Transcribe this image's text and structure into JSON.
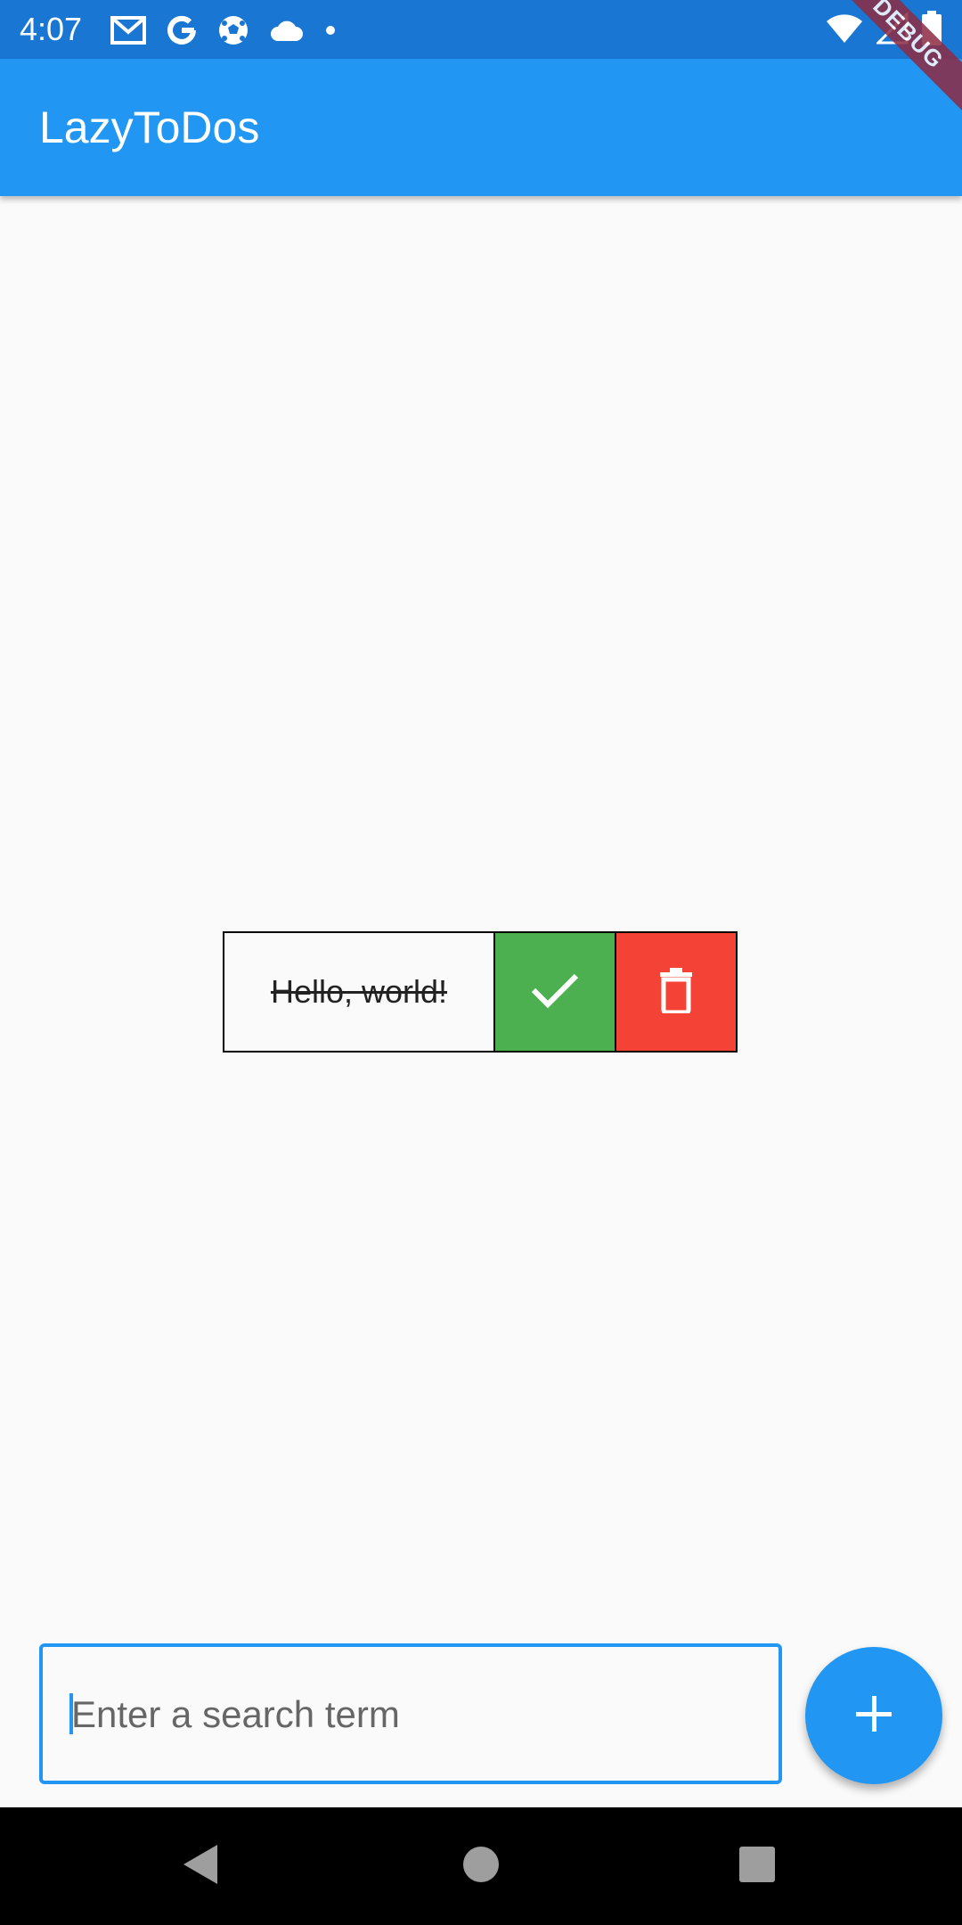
{
  "status_bar": {
    "time": "4:07",
    "left_icons": [
      "gmail-icon",
      "google-icon",
      "soccer-ball-icon",
      "cloud-icon",
      "dot-icon"
    ],
    "right_icons": [
      "wifi-icon",
      "signal-icon",
      "battery-icon"
    ]
  },
  "app_bar": {
    "title": "LazyToDos"
  },
  "debug_banner": {
    "label": "DEBUG"
  },
  "todo": {
    "text": "Hello, world!",
    "completed": true,
    "done_icon": "check-icon",
    "delete_icon": "trash-icon"
  },
  "search": {
    "placeholder": "Enter a search term",
    "value": ""
  },
  "fab": {
    "icon": "plus-icon"
  },
  "nav_bar": {
    "buttons": [
      "back-icon",
      "home-icon",
      "recents-icon"
    ]
  },
  "colors": {
    "status_bar": "#1976d2",
    "primary": "#2196f3",
    "done": "#4caf50",
    "delete": "#f44336",
    "debug": "#8e2b43",
    "background": "#fafafa"
  }
}
